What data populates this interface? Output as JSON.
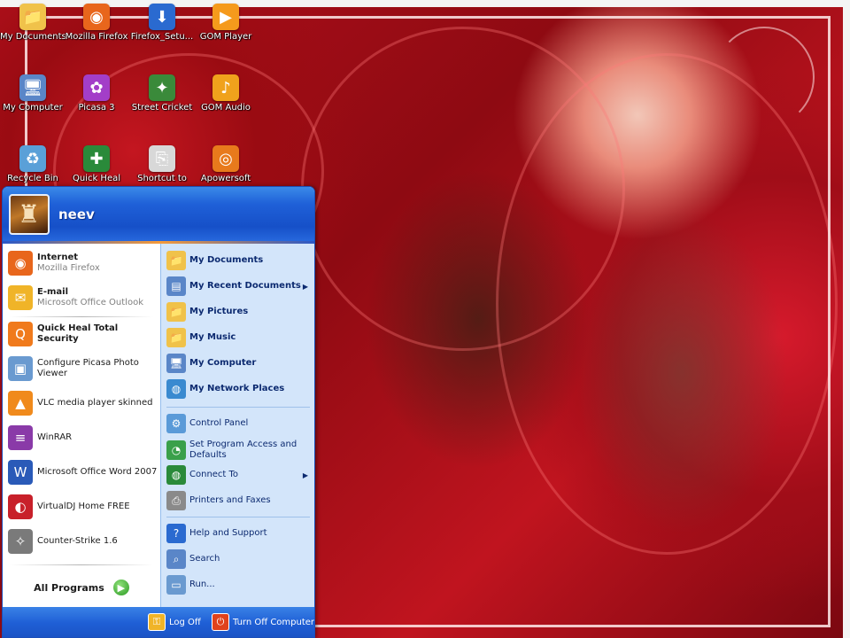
{
  "desktop": {
    "icons": [
      {
        "label": "My Documents",
        "icon": "folder-documents-icon",
        "color": "#f0c24a",
        "glyph": "📁"
      },
      {
        "label": "Mozilla Firefox",
        "icon": "firefox-icon",
        "color": "#e8661c",
        "glyph": "◉"
      },
      {
        "label": "Firefox_Setu...",
        "icon": "installer-icon",
        "color": "#2a6ad0",
        "glyph": "⬇"
      },
      {
        "label": "GOM Player",
        "icon": "gom-player-icon",
        "color": "#f59a1c",
        "glyph": "▶"
      },
      {
        "label": "My Computer",
        "icon": "computer-icon",
        "color": "#5a86c8",
        "glyph": "🖥"
      },
      {
        "label": "Picasa 3",
        "icon": "picasa-icon",
        "color": "#a33ec8",
        "glyph": "✿"
      },
      {
        "label": "Street Cricket",
        "icon": "street-cricket-icon",
        "color": "#3a8a3a",
        "glyph": "✦"
      },
      {
        "label": "GOM Audio",
        "icon": "gom-audio-icon",
        "color": "#f0a21c",
        "glyph": "♪"
      },
      {
        "label": "Recycle Bin",
        "icon": "recycle-bin-icon",
        "color": "#5aa0d8",
        "glyph": "♻"
      },
      {
        "label": "Quick Heal",
        "icon": "quick-heal-icon",
        "color": "#2a8a3a",
        "glyph": "✚"
      },
      {
        "label": "Shortcut to",
        "icon": "shortcut-icon",
        "color": "#d8d8d8",
        "glyph": "⎘"
      },
      {
        "label": "Apowersoft",
        "icon": "apowersoft-icon",
        "color": "#e87a1c",
        "glyph": "◎"
      }
    ]
  },
  "start_menu": {
    "user_name": "neev",
    "pinned": [
      {
        "title": "Internet",
        "subtitle": "Mozilla Firefox",
        "icon": "firefox-icon",
        "color": "#e8661c",
        "glyph": "◉"
      },
      {
        "title": "E-mail",
        "subtitle": "Microsoft Office Outlook",
        "icon": "outlook-icon",
        "color": "#f0b428",
        "glyph": "✉"
      }
    ],
    "recent": [
      {
        "title": "Quick Heal Total Security",
        "bold": true,
        "icon": "quick-heal-icon",
        "color": "#f07a1c",
        "glyph": "Q"
      },
      {
        "title": "Configure Picasa Photo Viewer",
        "bold": false,
        "icon": "picasa-viewer-icon",
        "color": "#6a9ad0",
        "glyph": "▣"
      },
      {
        "title": "VLC media player skinned",
        "bold": false,
        "icon": "vlc-icon",
        "color": "#f08a1c",
        "glyph": "▲"
      },
      {
        "title": "WinRAR",
        "bold": false,
        "icon": "winrar-icon",
        "color": "#8a3aa8",
        "glyph": "≡"
      },
      {
        "title": "Microsoft Office Word 2007",
        "bold": false,
        "icon": "word-icon",
        "color": "#2a5ab8",
        "glyph": "W"
      },
      {
        "title": "VirtualDJ Home FREE",
        "bold": false,
        "icon": "virtualdj-icon",
        "color": "#c8202a",
        "glyph": "◐"
      },
      {
        "title": "Counter-Strike 1.6",
        "bold": false,
        "icon": "counter-strike-icon",
        "color": "#7a7a7a",
        "glyph": "✧"
      }
    ],
    "all_programs": "All Programs",
    "places": [
      {
        "label": "My Documents",
        "icon": "folder-documents-icon",
        "color": "#f0c24a",
        "glyph": "📁",
        "arrow": false
      },
      {
        "label": "My Recent Documents",
        "icon": "recent-documents-icon",
        "color": "#5a86c8",
        "glyph": "▤",
        "arrow": true
      },
      {
        "label": "My Pictures",
        "icon": "folder-pictures-icon",
        "color": "#f0c24a",
        "glyph": "📁",
        "arrow": false
      },
      {
        "label": "My Music",
        "icon": "folder-music-icon",
        "color": "#f0c24a",
        "glyph": "📁",
        "arrow": false
      },
      {
        "label": "My Computer",
        "icon": "computer-icon",
        "color": "#5a86c8",
        "glyph": "🖥",
        "arrow": false
      },
      {
        "label": "My Network Places",
        "icon": "network-icon",
        "color": "#3a8ad0",
        "glyph": "◍",
        "arrow": false
      }
    ],
    "system": [
      {
        "label": "Control Panel",
        "icon": "control-panel-icon",
        "color": "#5a9ad8",
        "glyph": "⚙",
        "arrow": false
      },
      {
        "label": "Set Program Access and Defaults",
        "icon": "program-access-icon",
        "color": "#3aa04a",
        "glyph": "◔",
        "arrow": false
      },
      {
        "label": "Connect To",
        "icon": "connect-to-icon",
        "color": "#2a8a3a",
        "glyph": "◍",
        "arrow": true
      },
      {
        "label": "Printers and Faxes",
        "icon": "printer-icon",
        "color": "#8a8a8a",
        "glyph": "⎙",
        "arrow": false
      }
    ],
    "support": [
      {
        "label": "Help and Support",
        "icon": "help-icon",
        "color": "#2a6ad0",
        "glyph": "?",
        "arrow": false
      },
      {
        "label": "Search",
        "icon": "search-icon",
        "color": "#5a86c8",
        "glyph": "⌕",
        "arrow": false
      },
      {
        "label": "Run...",
        "icon": "run-icon",
        "color": "#6a9ad0",
        "glyph": "▭",
        "arrow": false
      }
    ],
    "log_off": "Log Off",
    "turn_off": "Turn Off Computer"
  }
}
